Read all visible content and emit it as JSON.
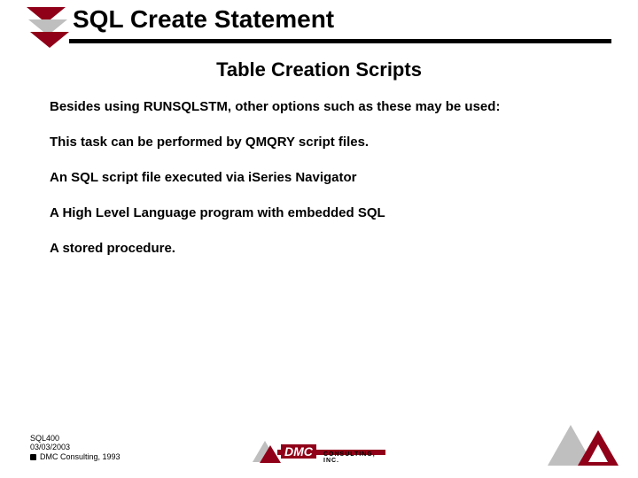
{
  "title": "SQL Create Statement",
  "subtitle": "Table Creation Scripts",
  "paragraphs": [
    "Besides using RUNSQLSTM, other options such as these may be used:",
    "This task can be performed by QMQRY script files.",
    "An SQL script file executed via iSeries Navigator",
    "A High Level Language program with embedded SQL",
    "A stored procedure."
  ],
  "footer": {
    "code": "SQL400",
    "date": "03/03/2003",
    "copyright": "DMC Consulting, 1993"
  },
  "logo": {
    "brand": "DMC",
    "suffix": "CONSULTING, INC."
  }
}
